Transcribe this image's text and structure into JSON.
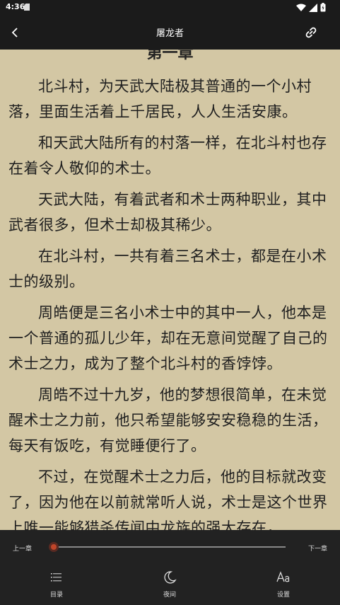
{
  "status_bar": {
    "time": "4:36"
  },
  "app_bar": {
    "title": "屠龙者"
  },
  "reader": {
    "chapter_title": "第一章",
    "paragraphs": [
      "北斗村，为天武大陆极其普通的一个小村落，里面生活着上千居民，人人生活安康。",
      "和天武大陆所有的村落一样，在北斗村也存在着令人敬仰的术士。",
      "天武大陆，有着武者和术士两种职业，其中武者很多，但术士却极其稀少。",
      "在北斗村，一共有着三名术士，都是在小术士的级别。",
      "周皓便是三名小术士中的其中一人，他本是一个普通的孤儿少年，却在无意间觉醒了自己的术士之力，成为了整个北斗村的香饽饽。",
      "周皓不过十九岁，他的梦想很简单，在未觉醒术士之力前，他只希望能够安安稳稳的生活，每天有饭吃，有觉睡便行了。",
      "不过，在觉醒术士之力后，他的目标就改变了，因为他在以前就常听人说，术士是这个世界上唯一能够猎杀传闻中龙族的强大存在，"
    ]
  },
  "controls": {
    "prev_label": "上一章",
    "next_label": "下一章",
    "progress": 0.0,
    "tabs": [
      {
        "label": "目录",
        "icon": "list-icon"
      },
      {
        "label": "夜间",
        "icon": "moon-icon"
      },
      {
        "label": "设置",
        "icon": "font-settings-icon"
      }
    ],
    "accent_color": "#c0462a"
  }
}
